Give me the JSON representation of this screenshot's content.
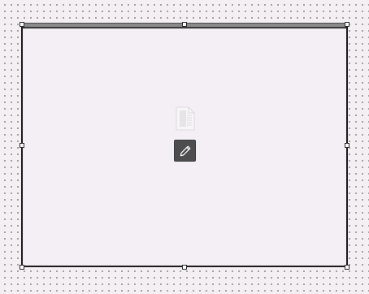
{
  "canvas": {
    "background": "#f3eff3",
    "grid_dot_color": "#8e8a8e"
  },
  "selected_frame": {
    "fill": "#f3eff4",
    "border_color": "#1c1a1c",
    "topbar_color": "#8b8a8b",
    "handles": [
      "top-left",
      "top-middle",
      "top-right",
      "middle-left",
      "middle-right",
      "bottom-left",
      "bottom-middle",
      "bottom-right"
    ]
  },
  "placeholder": {
    "icon": "document-page-icon",
    "icon_color": "#dcdadc"
  },
  "edit_button": {
    "icon": "pencil-icon",
    "background": "#4d4d4f",
    "icon_color": "#ffffff"
  }
}
